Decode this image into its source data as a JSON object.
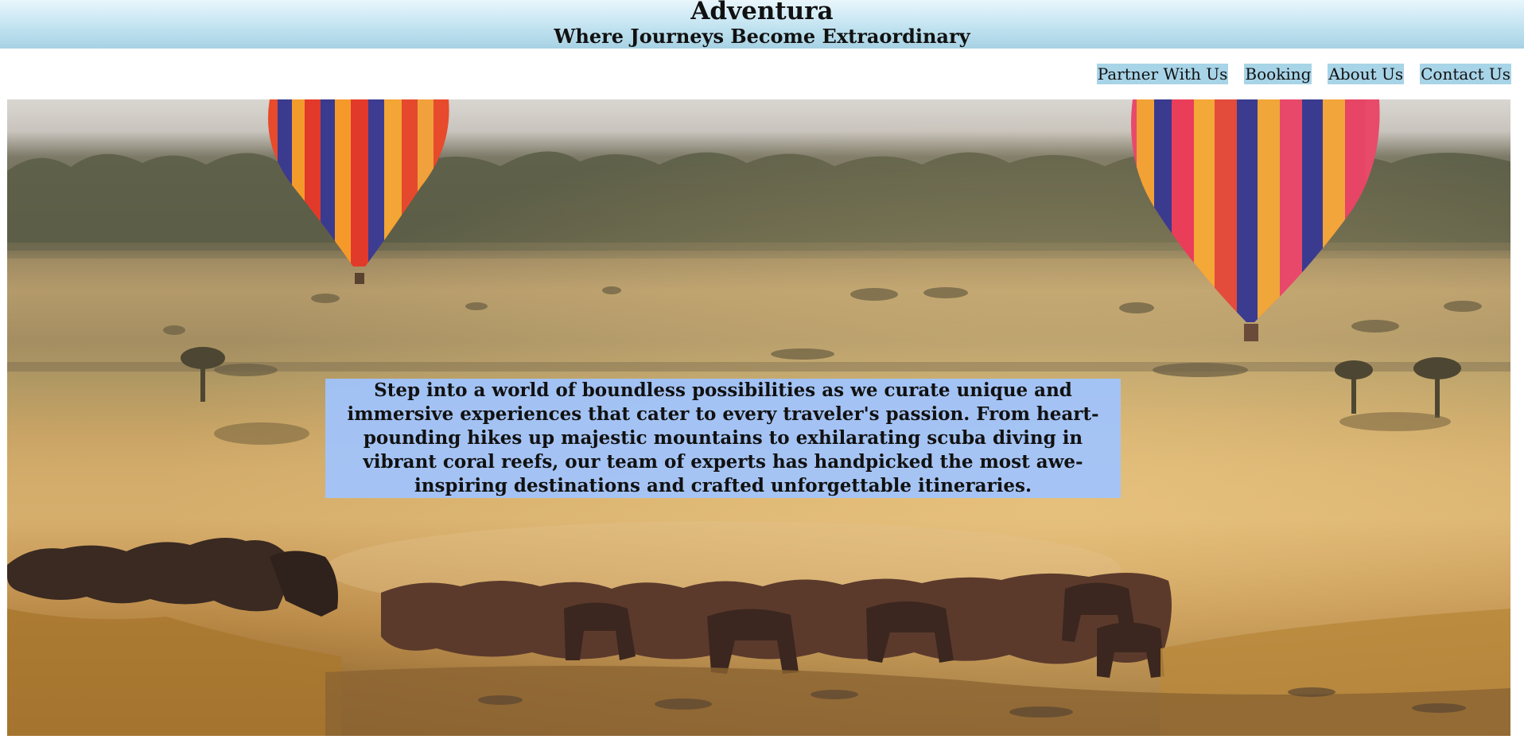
{
  "header": {
    "title": "Adventura",
    "tagline": "Where Journeys Become Extraordinary"
  },
  "nav": {
    "items": [
      {
        "label": "Partner With Us"
      },
      {
        "label": "Booking"
      },
      {
        "label": "About Us"
      },
      {
        "label": "Contact Us"
      }
    ]
  },
  "hero": {
    "image": "safari-hot-air-balloons-wildebeest",
    "text": "Step into a world of boundless possibilities as we curate unique and immersive experiences that cater to every traveler's passion. From heart-pounding hikes up majestic mountains to exhilarating scuba diving in vibrant coral reefs, our team of experts has handpicked the most awe-inspiring destinations and crafted unforgettable itineraries."
  },
  "colors": {
    "header_gradient_top": "#e9f6fc",
    "header_gradient_bottom": "#a6d2e4",
    "nav_highlight": "#a8d4e8",
    "hero_text_background": "#9fc4ff"
  }
}
